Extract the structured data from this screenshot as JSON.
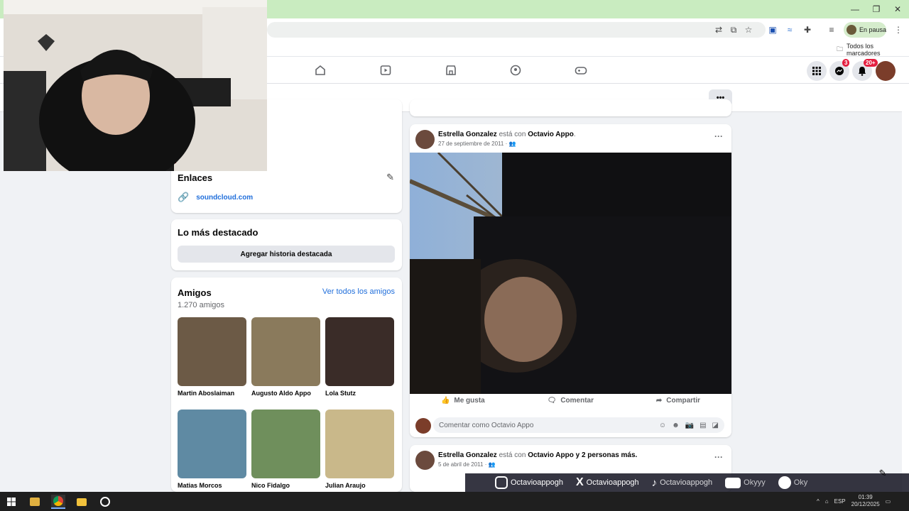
{
  "browser": {
    "profile_label": "En pausa",
    "bookmarks_label": "Todos los marcadores",
    "window_controls": [
      "minimize-icon",
      "restore-icon",
      "close-icon"
    ]
  },
  "fb_nav": {
    "icons": [
      "home-icon",
      "video-icon",
      "marketplace-icon",
      "groups-icon",
      "gaming-icon"
    ],
    "messenger_badge": "3",
    "notifications_badge": "20+"
  },
  "subnav": {
    "more_label": "•••"
  },
  "sidebar": {
    "links_card": {
      "title": "Enlaces",
      "link": "soundcloud.com"
    },
    "highlights_card": {
      "title": "Lo más destacado",
      "button": "Agregar historia destacada"
    },
    "friends_card": {
      "title": "Amigos",
      "count": "1.270 amigos",
      "see_all": "Ver todos los amigos",
      "friends": [
        {
          "name": "Martin Aboslaiman",
          "color": "#6c5a46"
        },
        {
          "name": "Augusto Aldo Appo",
          "color": "#8a7a5c"
        },
        {
          "name": "Lola Stutz",
          "color": "#3a2c28"
        },
        {
          "name": "Matias Morcos",
          "color": "#5f8aa3"
        },
        {
          "name": "Nico Fidalgo",
          "color": "#6f8f5c"
        },
        {
          "name": "Julian Araujo",
          "color": "#c9b88a"
        }
      ]
    }
  },
  "posts": [
    {
      "author": "Estrella Gonzalez",
      "mid": "está con",
      "with": "Octavio Appo",
      "extra": "",
      "date": "27 de septiembre de 2011",
      "actions": {
        "like": "Me gusta",
        "comment": "Comentar",
        "share": "Compartir"
      },
      "comment_placeholder": "Comentar como Octavio Appo"
    },
    {
      "author": "Estrella Gonzalez",
      "mid": "está con",
      "with": "Octavio Appo",
      "extra": "y 2 personas más.",
      "date": "5 de abril de 2011"
    }
  ],
  "stream_overlay": {
    "instagram": "Octavioappogh",
    "x": "Octavioappogh",
    "tiktok": "Octavioappogh",
    "youtube": "Okyyy",
    "spotify": "Oky"
  },
  "taskbar": {
    "lang": "ESP",
    "time": "01:39",
    "date": "20/12/2025"
  },
  "colors": {
    "accent": "#1877f2",
    "link": "#216fdb",
    "badge": "#e41e3f"
  }
}
